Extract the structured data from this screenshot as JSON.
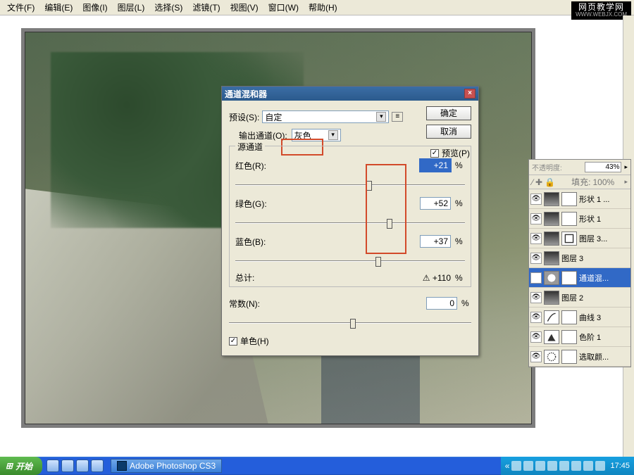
{
  "menu": {
    "file": "文件(F)",
    "edit": "编辑(E)",
    "image": "图像(I)",
    "layer": "图层(L)",
    "select": "选择(S)",
    "filter": "滤镜(T)",
    "view": "视图(V)",
    "window": "窗口(W)",
    "help": "帮助(H)"
  },
  "watermark": {
    "title": "网页教学网",
    "sub": "WWW.WEBJX.COM"
  },
  "dialog": {
    "title": "通道混和器",
    "preset_lbl": "预设(S):",
    "preset_val": "自定",
    "outch_lbl": "输出通道(O):",
    "outch_val": "灰色",
    "src_legend": "源通道",
    "red_lbl": "红色(R):",
    "green_lbl": "绿色(G):",
    "blue_lbl": "蓝色(B):",
    "red_val": "+21",
    "green_val": "+52",
    "blue_val": "+37",
    "pct": "%",
    "total_lbl": "总计:",
    "total_val": "+110",
    "const_lbl": "常数(N):",
    "const_val": "0",
    "mono_lbl": "单色(H)",
    "ok": "确定",
    "cancel": "取消",
    "preview": "预览(P)",
    "warn": "⚠"
  },
  "layers": {
    "opacity_lbl": "不透明度:",
    "opacity_val": "43%",
    "fill_lbl": "填充:",
    "fill_val": "100%",
    "items": [
      {
        "name": "形状 1 ..."
      },
      {
        "name": "形状 1"
      },
      {
        "name": "图层 3..."
      },
      {
        "name": "图层 3"
      },
      {
        "name": "通道混..."
      },
      {
        "name": "图层 2"
      },
      {
        "name": "曲线 3"
      },
      {
        "name": "色阶 1"
      },
      {
        "name": "选取颜..."
      }
    ]
  },
  "taskbar": {
    "start": "开始",
    "task": "Adobe Photoshop CS3",
    "clock": "17:45"
  }
}
